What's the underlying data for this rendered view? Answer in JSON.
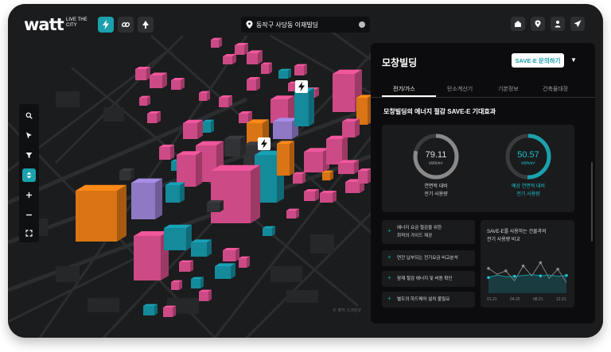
{
  "header": {
    "logo": "watt",
    "tagline_line1": "LIVE THE",
    "tagline_line2": "CITY",
    "search_value": "동작구 사당동 이재빌딩"
  },
  "icons": {
    "left_toolbar": [
      "lightning-icon",
      "link-icon",
      "tree-icon"
    ],
    "right_toolbar": [
      "home-icon",
      "pin-icon",
      "person-icon",
      "send-icon"
    ],
    "map_tools": [
      "search-icon",
      "pointer-icon",
      "filter-icon",
      "level-icon",
      "plus-icon",
      "minus-icon",
      "fullscreen-icon"
    ]
  },
  "panel": {
    "title": "모창빌딩",
    "cta_label": "SAVE-E 문의하기",
    "tabs": [
      "전기/가스",
      "탄소계산기",
      "기본정보",
      "건축물대장"
    ],
    "section_title": "모창빌딩의 에너지 절감 SAVE-E 기대효과",
    "ring1": {
      "value": "79.11",
      "unit": "kWh/m²",
      "label_line1": "연면적 대비",
      "label_line2": "전기 사용량",
      "percent": 79.11
    },
    "ring2": {
      "value": "50.57",
      "unit": "kWh/m²",
      "label_line1": "예상 연면적 대비",
      "label_line2": "전기 사용량",
      "percent": 50.57
    },
    "benefits": [
      "에너지 요금 절감을 위한",
      "최적의 가이드 제공",
      "연간 납부되는 전기요금 비교분석",
      "잠재 절감 에너지 및 비용 확인",
      "별도의 하드웨어 설치 불필요"
    ],
    "chart_title_line1": "SAVE-E를 사용하는 건물과의",
    "chart_title_line2": "전기 사용량 비교"
  },
  "watermark": "© 출처 스크린샷",
  "colors": {
    "accent": "#1aa1ad",
    "pink": "#f0579c",
    "orange": "#ff8a18",
    "purple": "#a88de6",
    "teal": "#18a2b6"
  },
  "chart_data": {
    "type": "line",
    "title": "",
    "x": [
      "01.21",
      "04.20",
      "08.21",
      "12.21"
    ],
    "series": [
      {
        "values": [
          60,
          46,
          54,
          30,
          66,
          42,
          74,
          36,
          58,
          26
        ]
      },
      {
        "values": [
          38,
          44,
          40,
          41,
          43,
          45,
          42,
          44,
          41,
          43
        ]
      }
    ],
    "ylim": [
      0,
      100
    ]
  }
}
